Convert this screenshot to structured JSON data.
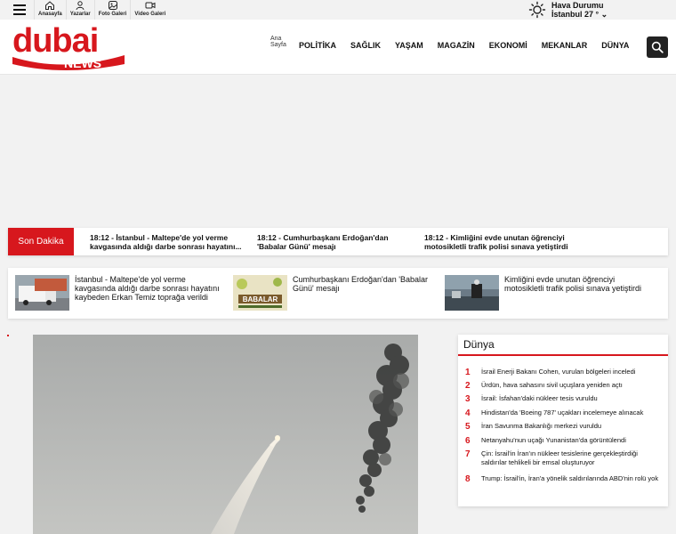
{
  "topbar": {
    "quick_nav": [
      {
        "label": "Anasayfa",
        "icon": "home-icon"
      },
      {
        "label": "Yazarlar",
        "icon": "user-icon"
      },
      {
        "label": "Foto Galeri",
        "icon": "photo-icon"
      },
      {
        "label": "Video Galeri",
        "icon": "video-icon"
      }
    ],
    "weather": {
      "title": "Hava Durumu",
      "city_temp": "İstanbul 27 °"
    }
  },
  "header": {
    "logo_top": "dubai",
    "logo_bottom": "NEWS",
    "home_alt": "Ana Sayfa",
    "menu": [
      "POLİTİKA",
      "SAĞLIK",
      "YAŞAM",
      "MAGAZİN",
      "EKONOMİ",
      "MEKANLAR",
      "DÜNYA"
    ]
  },
  "breaking": {
    "label": "Son Dakika",
    "items": [
      {
        "time": "18:12",
        "text": "İstanbul - Maltepe'de yol verme kavgasında aldığı darbe sonrası hayatını..."
      },
      {
        "time": "18:12",
        "text": "Cumhurbaşkanı Erdoğan'dan 'Babalar Günü' mesajı"
      },
      {
        "time": "18:12",
        "text": "Kimliğini evde unutan öğrenciyi motosikletli trafik polisi sınava yetiştirdi"
      }
    ]
  },
  "featured": [
    {
      "text": "İstanbul - Maltepe'de yol verme kavgasında aldığı darbe sonrası hayatını kaybeden Erkan Temiz toprağa verildi"
    },
    {
      "text": "Cumhurbaşkanı Erdoğan'dan 'Babalar Günü' mesajı",
      "thumb_text": "BABALAR"
    },
    {
      "text": "Kimliğini evde unutan öğrenciyi motosikletli trafik polisi sınava yetiştirdi"
    }
  ],
  "sidebar": {
    "title": "Dünya",
    "items": [
      {
        "num": "1",
        "text": "İsrail Enerji Bakanı Cohen, vurulan bölgeleri inceledi"
      },
      {
        "num": "2",
        "text": "Ürdün, hava sahasını sivil uçuşlara yeniden açtı"
      },
      {
        "num": "3",
        "text": "İsrail: İsfahan'daki nükleer tesis vuruldu"
      },
      {
        "num": "4",
        "text": "Hindistan'da 'Boeing 787' uçakları incelemeye alınacak"
      },
      {
        "num": "5",
        "text": "İran Savunma Bakanlığı merkezi vuruldu"
      },
      {
        "num": "6",
        "text": "Netanyahu'nun uçağı Yunanistan'da görüntülendi"
      },
      {
        "num": "7",
        "text": "Çin: İsrail'in İran'ın nükleer tesislerine gerçekleştirdiği saldırılar tehlikeli bir emsal oluşturuyor"
      },
      {
        "num": "8",
        "text": "Trump: İsrail'in, İran'a yönelik saldırılarında ABD'nin rolü yok"
      }
    ]
  },
  "colors": {
    "brand_red": "#d7171d",
    "dark": "#222222"
  }
}
